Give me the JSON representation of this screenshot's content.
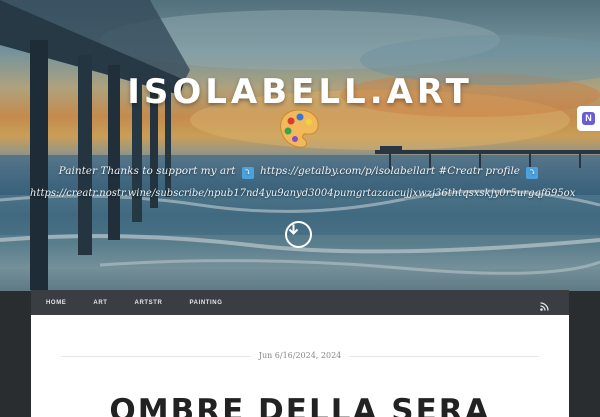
{
  "site": {
    "title": "ISOLABELL.ART",
    "tagline_prefix": "Painter Thanks to support my art",
    "tagline_link": "https://getalby.com/p/isolabellart",
    "tagline_suffix": "#Creatr profile",
    "tagline_url": "https://creatr.nostr.wine/subscribe/npub17nd4yu9anyd3004pumgrtazaacujjxwzj36thtqsxskjy0r5urgqf695ox"
  },
  "nav": {
    "items": [
      "Home",
      "ART",
      "ARTSTR",
      "PAINTING"
    ]
  },
  "post": {
    "date": "Jun 6/16/2024, 2024",
    "title": "OMBRE DELLA SERA"
  },
  "side_badge": {
    "label": "N"
  },
  "colors": {
    "accent": "#4aa3df",
    "nav_bg": "#3a3d42",
    "badge": "#6a5bd8"
  },
  "icons": {
    "palette": "artist-palette-icon",
    "scroll": "arrow-down-icon",
    "rss": "rss-icon",
    "emoji": "arrow-down-emoji-icon"
  }
}
